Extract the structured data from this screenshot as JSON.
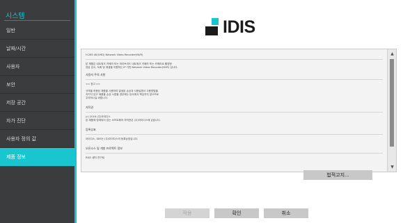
{
  "sidebar": {
    "title": "시스템",
    "items": [
      {
        "label": "일반",
        "active": false
      },
      {
        "label": "날짜/시간",
        "active": false
      },
      {
        "label": "사용자",
        "active": false
      },
      {
        "label": "보안",
        "active": false
      },
      {
        "label": "저장 공간",
        "active": false
      },
      {
        "label": "자가 진단",
        "active": false
      },
      {
        "label": "사용자 정의 값",
        "active": false
      },
      {
        "label": "제품 정보",
        "active": true
      }
    ]
  },
  "logo": {
    "text": "IDIS"
  },
  "license": {
    "title": "H.265 4K(UHD) Network Video Recorder(NVR)",
    "intro_1": "본 제품은 네트워크 카메라 또는 하이브리드 네트워크 카메라 또는 카메라로 촬영한",
    "intro_2": "영상 감시, 녹화 및 재생을 지원하는 IP 기반 Network Video Recorder(NVR) 입니다.",
    "caution_title": "사용자 주의 사항",
    "warning_title": "<< 경고 >>",
    "warning_1": "규격을 허용된 제품을 사용하여 발생된 손상과 사용설명서 사용방법을",
    "warning_2": "지키지 않고 제품을 손상 시켰을 경우에는 당사에서 책임지지 않으므로",
    "warning_3": "주의하시길 바랍니다.",
    "copyright_title": "저작권",
    "copyright_1": "(c) 2016 (주)아이디스",
    "copyright_2": "본 제품에 탑재되어 있는 소프트웨어 저작권은 (주)아이디스에 있습니다.",
    "trademark_title": "등록상표",
    "trademark_1": "아이디스, IDIS는 (주)아이디스의 등록상표입니다.",
    "opensource_title": "오픈소스 및 개발 프로젝트 정보",
    "opensource_1": "R&D 센터 연구팀"
  },
  "buttons": {
    "license": "법적고지...",
    "apply": "적용",
    "ok": "확인",
    "cancel": "취소"
  }
}
